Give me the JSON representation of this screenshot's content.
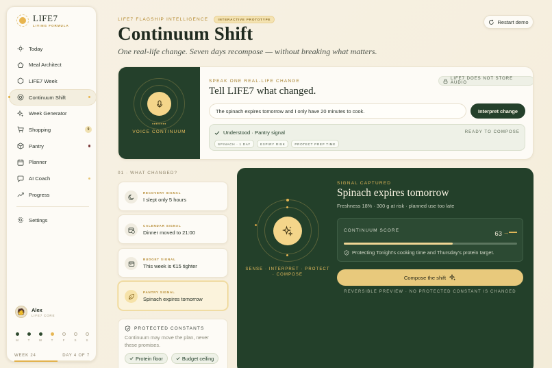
{
  "brand": {
    "name": "LIFE7",
    "sub": "LIVING FORMULA"
  },
  "nav": [
    {
      "label": "Today"
    },
    {
      "label": "Meal Architect"
    },
    {
      "label": "LIFE7 Week"
    },
    {
      "label": "Continuum Shift",
      "active": true
    },
    {
      "label": "Week Generator"
    },
    {
      "label": "Shopping",
      "badge": "9"
    },
    {
      "label": "Pantry"
    },
    {
      "label": "Planner"
    },
    {
      "label": "AI Coach"
    },
    {
      "label": "Progress"
    },
    {
      "label": "Settings"
    }
  ],
  "user": {
    "name": "Alex",
    "tier": "LIFE7 CORE"
  },
  "week": {
    "days": [
      "M",
      "T",
      "W",
      "T",
      "F",
      "S",
      "S"
    ],
    "week_label": "WEEK 24",
    "day_label": "DAY 4 OF 7",
    "progress": 0.57
  },
  "header": {
    "eyebrow": "LIFE7 FLAGSHIP INTELLIGENCE",
    "badge": "INTERACTIVE PROTOTYPE",
    "title": "Continuum Shift",
    "subtitle": "One real-life change. Seven days recompose — without breaking what matters.",
    "restart": "Restart demo"
  },
  "voice": {
    "label": "VOICE CONTINUUM",
    "dots": "••••••••",
    "eyebrow": "SPEAK ONE REAL-LIFE CHANGE",
    "title": "Tell LIFE7 what changed.",
    "no_audio": "LIFE7 DOES NOT STORE AUDIO",
    "input_value": "The spinach expires tomorrow and I only have 20 minutes to cook.",
    "interpret": "Interpret change",
    "understood": "Understood · Pantry signal",
    "ready": "READY TO COMPOSE",
    "tags": [
      "SPINACH · 1 DAY",
      "EXPIRY RISK",
      "PROTECT PREP TIME"
    ]
  },
  "what_changed": {
    "label": "01 · WHAT CHANGED?",
    "signals": [
      {
        "kind": "RECOVERY SIGNAL",
        "value": "I slept only 5 hours",
        "icon": "moon-icon"
      },
      {
        "kind": "CALENDAR SIGNAL",
        "value": "Dinner moved to 21:00",
        "icon": "calendar-icon"
      },
      {
        "kind": "BUDGET SIGNAL",
        "value": "This week is €15 tighter",
        "icon": "wallet-icon"
      },
      {
        "kind": "PANTRY SIGNAL",
        "value": "Spinach expires tomorrow",
        "icon": "leaf-icon",
        "active": true
      }
    ]
  },
  "constants": {
    "title": "PROTECTED CONSTANTS",
    "text": "Continuum may move the plan, never these promises.",
    "chips": [
      "Protein floor",
      "Budget ceiling"
    ]
  },
  "captured": {
    "sip": "SENSE · INTERPRET · PROTECT · COMPOSE",
    "eyebrow": "SIGNAL CAPTURED",
    "title": "Spinach expires tomorrow",
    "meta": "Freshness 18% · 300 g at risk · planned use too late",
    "score_label": "CONTINUUM SCORE",
    "score": "63",
    "score_arrow": "→",
    "score_progress": 0.63,
    "protecting": "Protecting Tonight's cooking time and Thursday's protein target.",
    "compose": "Compose the shift",
    "reversible": "REVERSIBLE PREVIEW · NO PROTECTED CONSTANT IS CHANGED"
  },
  "colors": {
    "forest": "#24402b",
    "gold": "#e7b653",
    "cream": "#fdfbf6",
    "sage_bg": "#eef1e7"
  }
}
